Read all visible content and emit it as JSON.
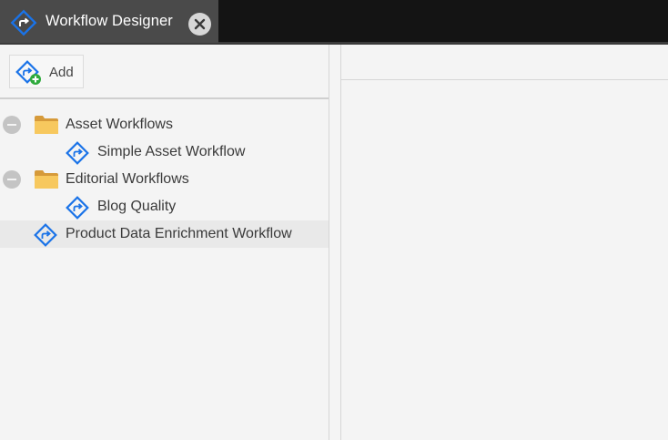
{
  "window": {
    "tab_title": "Workflow Designer",
    "close_icon": "close-icon",
    "tab_icon": "workflow-icon"
  },
  "toolbar": {
    "add_label": "Add",
    "add_icon": "add-workflow-icon"
  },
  "tree": {
    "items": [
      {
        "label": "Asset Workflows",
        "type": "folder",
        "level": 0,
        "expanded": true
      },
      {
        "label": "Simple Asset Workflow",
        "type": "workflow",
        "level": 1
      },
      {
        "label": "Editorial Workflows",
        "type": "folder",
        "level": 0,
        "expanded": true
      },
      {
        "label": "Blog Quality",
        "type": "workflow",
        "level": 1
      },
      {
        "label": "Product Data Enrichment Workflow",
        "type": "workflow",
        "level": 0,
        "selected": true
      }
    ]
  },
  "colors": {
    "accent_blue": "#1a73e8",
    "add_green": "#2eaa3c",
    "folder_yellow": "#f4c35a",
    "topbar": "#141414",
    "active_tab": "#4a4a4a"
  }
}
